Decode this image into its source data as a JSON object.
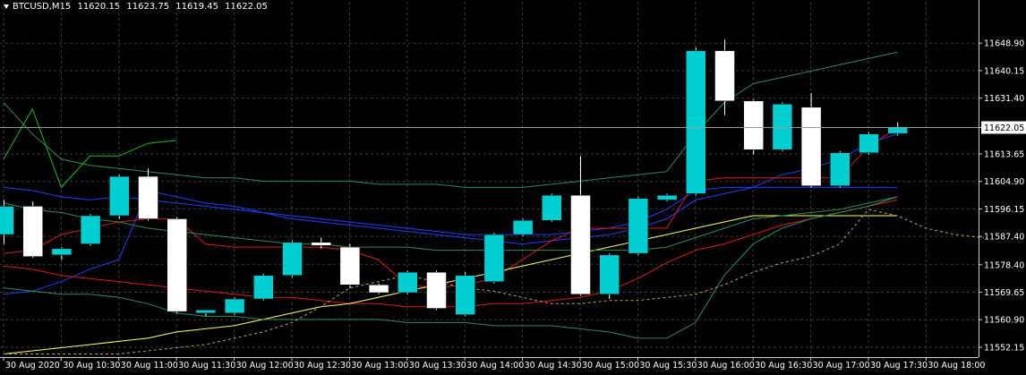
{
  "header": {
    "symbol_timeframe": "BTCUSD,M15",
    "open": "11620.15",
    "high": "11623.75",
    "low": "11619.45",
    "close": "11622.05"
  },
  "colors": {
    "background": "#000000",
    "grid": "#3b3b3b",
    "bull_candle": "#00CED1",
    "bear_candle": "#ffffff",
    "ma_blue": "#1f3fff",
    "ma_red": "#e01818",
    "ma_yellow": "#ffff66",
    "ma_green": "#2e8b57",
    "bollinger": "#1fb81f",
    "orange_dotted": "#d2a050"
  },
  "chart_data": {
    "type": "candlestick",
    "ylim": [
      11549.0,
      11657.5
    ],
    "y_tick_labels": [
      "11648.90",
      "11640.15",
      "11631.40",
      "11622.05",
      "11613.65",
      "11604.90",
      "11596.15",
      "11587.40",
      "11578.40",
      "11569.65",
      "11560.90",
      "11552.15"
    ],
    "y_ticks": [
      11648.9,
      11640.15,
      11631.4,
      11613.65,
      11604.9,
      11596.15,
      11587.4,
      11578.4,
      11569.65,
      11560.9,
      11552.15
    ],
    "current_price": "11622.05",
    "current_price_value": 11622.05,
    "x_tick_labels": [
      "30 Aug 2020",
      "30 Aug 10:30",
      "30 Aug 11:00",
      "30 Aug 11:30",
      "30 Aug 12:00",
      "30 Aug 12:30",
      "30 Aug 13:00",
      "30 Aug 13:30",
      "30 Aug 14:00",
      "30 Aug 14:30",
      "30 Aug 15:00",
      "30 Aug 15:30",
      "30 Aug 16:00",
      "30 Aug 16:30",
      "30 Aug 17:00",
      "30 Aug 17:30",
      "30 Aug 18:00"
    ],
    "candles": [
      {
        "o": 11588.0,
        "h": 11599.0,
        "l": 11585.0,
        "c": 11597.0
      },
      {
        "o": 11597.0,
        "h": 11598.5,
        "l": 11580.5,
        "c": 11581.0
      },
      {
        "o": 11581.5,
        "h": 11584.0,
        "l": 11580.0,
        "c": 11583.5
      },
      {
        "o": 11585.0,
        "h": 11594.5,
        "l": 11584.5,
        "c": 11594.0
      },
      {
        "o": 11594.0,
        "h": 11607.0,
        "l": 11593.0,
        "c": 11606.5
      },
      {
        "o": 11606.5,
        "h": 11609.0,
        "l": 11592.5,
        "c": 11593.0
      },
      {
        "o": 11593.0,
        "h": 11593.5,
        "l": 11563.0,
        "c": 11563.5
      },
      {
        "o": 11563.0,
        "h": 11564.0,
        "l": 11562.0,
        "c": 11564.0
      },
      {
        "o": 11563.0,
        "h": 11568.0,
        "l": 11562.5,
        "c": 11567.5
      },
      {
        "o": 11567.5,
        "h": 11575.5,
        "l": 11567.0,
        "c": 11575.0
      },
      {
        "o": 11575.0,
        "h": 11586.0,
        "l": 11574.5,
        "c": 11585.5
      },
      {
        "o": 11585.5,
        "h": 11587.0,
        "l": 11583.5,
        "c": 11584.5
      },
      {
        "o": 11584.0,
        "h": 11585.0,
        "l": 11571.0,
        "c": 11572.0
      },
      {
        "o": 11572.0,
        "h": 11572.5,
        "l": 11569.0,
        "c": 11569.5
      },
      {
        "o": 11569.5,
        "h": 11576.5,
        "l": 11569.0,
        "c": 11576.0
      },
      {
        "o": 11576.0,
        "h": 11576.5,
        "l": 11564.0,
        "c": 11564.5
      },
      {
        "o": 11562.5,
        "h": 11576.0,
        "l": 11562.0,
        "c": 11575.0
      },
      {
        "o": 11573.0,
        "h": 11588.5,
        "l": 11572.5,
        "c": 11588.0
      },
      {
        "o": 11588.0,
        "h": 11593.0,
        "l": 11587.5,
        "c": 11592.5
      },
      {
        "o": 11592.5,
        "h": 11601.0,
        "l": 11592.0,
        "c": 11600.5
      },
      {
        "o": 11600.5,
        "h": 11613.0,
        "l": 11568.5,
        "c": 11569.0
      },
      {
        "o": 11569.0,
        "h": 11582.0,
        "l": 11567.5,
        "c": 11581.5
      },
      {
        "o": 11582.0,
        "h": 11600.0,
        "l": 11581.5,
        "c": 11599.5
      },
      {
        "o": 11599.0,
        "h": 11601.0,
        "l": 11598.5,
        "c": 11600.5
      },
      {
        "o": 11601.0,
        "h": 11647.5,
        "l": 11600.5,
        "c": 11646.5
      },
      {
        "o": 11646.5,
        "h": 11650.0,
        "l": 11626.0,
        "c": 11630.5
      },
      {
        "o": 11630.5,
        "h": 11631.0,
        "l": 11613.5,
        "c": 11615.0
      },
      {
        "o": 11615.0,
        "h": 11630.0,
        "l": 11614.5,
        "c": 11629.5
      },
      {
        "o": 11628.5,
        "h": 11633.0,
        "l": 11603.0,
        "c": 11603.5
      },
      {
        "o": 11603.5,
        "h": 11614.5,
        "l": 11603.0,
        "c": 11614.0
      },
      {
        "o": 11614.0,
        "h": 11620.5,
        "l": 11613.5,
        "c": 11620.0
      },
      {
        "o": 11620.15,
        "h": 11623.75,
        "l": 11619.45,
        "c": 11622.05
      }
    ],
    "series": [
      {
        "color": "#1f3fff",
        "values": [
          11569,
          11570,
          11573,
          11577,
          11580,
          11602,
          11600,
          11598,
          11597,
          11595,
          11593,
          11592,
          11591,
          11590,
          11589,
          11588,
          11587,
          11586,
          11585,
          11586,
          11587,
          11588,
          11590,
          11593,
          11599,
          11601,
          11603,
          11607,
          11609,
          11612,
          11617,
          11620
        ]
      },
      {
        "color": "#1f3fff",
        "values": [
          11603,
          11602,
          11600,
          11599,
          11600,
          11599,
          11598,
          11597,
          11596,
          11595,
          11594,
          11593,
          11592,
          11591,
          11590,
          11589,
          11588,
          11588,
          11588,
          11588,
          11589,
          11590,
          11592,
          11596,
          11602,
          11603,
          11603,
          11603,
          11603,
          11603,
          11603,
          11603
        ]
      },
      {
        "color": "#e01818",
        "values": [
          11582,
          11583,
          11588,
          11590,
          11592,
          11593,
          11593,
          11585,
          11584,
          11584,
          11584,
          11584,
          11583,
          11580,
          11572,
          11571,
          11572,
          11574,
          11580,
          11586,
          11590,
          11590,
          11590,
          11590,
          11605,
          11606,
          11606,
          11606,
          11606,
          11606,
          11616,
          11622
        ]
      },
      {
        "color": "#e01818",
        "values": [
          11578,
          11577,
          11575,
          11574,
          11573,
          11572,
          11571,
          11570,
          11569,
          11568,
          11568,
          11567,
          11566,
          11566,
          11565,
          11565,
          11565,
          11566,
          11566,
          11567,
          11568,
          11570,
          11574,
          11579,
          11583,
          11585,
          11588,
          11591,
          11593,
          11595,
          11597,
          11599
        ]
      },
      {
        "color": "#ffff66",
        "values": [
          11550,
          11551,
          11552,
          11553,
          11554,
          11555,
          11557,
          11558,
          11559,
          11561,
          11563,
          11565,
          11566,
          11568,
          11570,
          11572,
          11574,
          11576,
          11578,
          11580,
          11582,
          11584,
          11586,
          11588,
          11590,
          11592,
          11594,
          11594,
          11594,
          11594,
          11594,
          11594
        ]
      },
      {
        "color": "#2e8b57",
        "values": [
          11571,
          11570,
          11569,
          11569,
          11568,
          11566,
          11563,
          11562,
          11562,
          11561,
          11561,
          11561,
          11561,
          11561,
          11560,
          11560,
          11560,
          11559,
          11559,
          11559,
          11558,
          11557,
          11555,
          11555,
          11560,
          11575,
          11585,
          11590,
          11593,
          11595,
          11597,
          11600
        ]
      },
      {
        "color": "#2e8b57",
        "values": [
          11598,
          11596,
          11595,
          11593,
          11592,
          11590,
          11589,
          11588,
          11587,
          11586,
          11585,
          11585,
          11584,
          11584,
          11584,
          11583,
          11583,
          11583,
          11583,
          11583,
          11583,
          11583,
          11583,
          11584,
          11587,
          11590,
          11593,
          11594,
          11595,
          11596,
          11598,
          11600
        ]
      },
      {
        "color": "#2e8b57",
        "values": [
          11630,
          11620,
          11612,
          11610,
          11609,
          11608,
          11607,
          11606,
          11606,
          11605,
          11605,
          11605,
          11605,
          11604,
          11604,
          11604,
          11603,
          11603,
          11603,
          11604,
          11605,
          11606,
          11607,
          11608,
          11620,
          11630,
          11636,
          11638,
          11640,
          11642,
          11644,
          11646
        ]
      },
      {
        "color": "#1fb81f",
        "values": [
          11612,
          11628,
          11603,
          11613,
          11613,
          11617,
          11618
        ]
      },
      {
        "color": "#d2a050",
        "values": [
          11550,
          11550,
          11550,
          11550,
          11550,
          11551,
          11552,
          11553,
          11555,
          11557,
          11560,
          11565,
          11571,
          11573,
          11575,
          11573,
          11571,
          11570,
          11568,
          11566,
          11566,
          11567,
          11567,
          11568,
          11569,
          11572,
          11576,
          11579,
          11581,
          11585,
          11596,
          11594,
          11590,
          11588,
          11587
        ]
      }
    ]
  }
}
